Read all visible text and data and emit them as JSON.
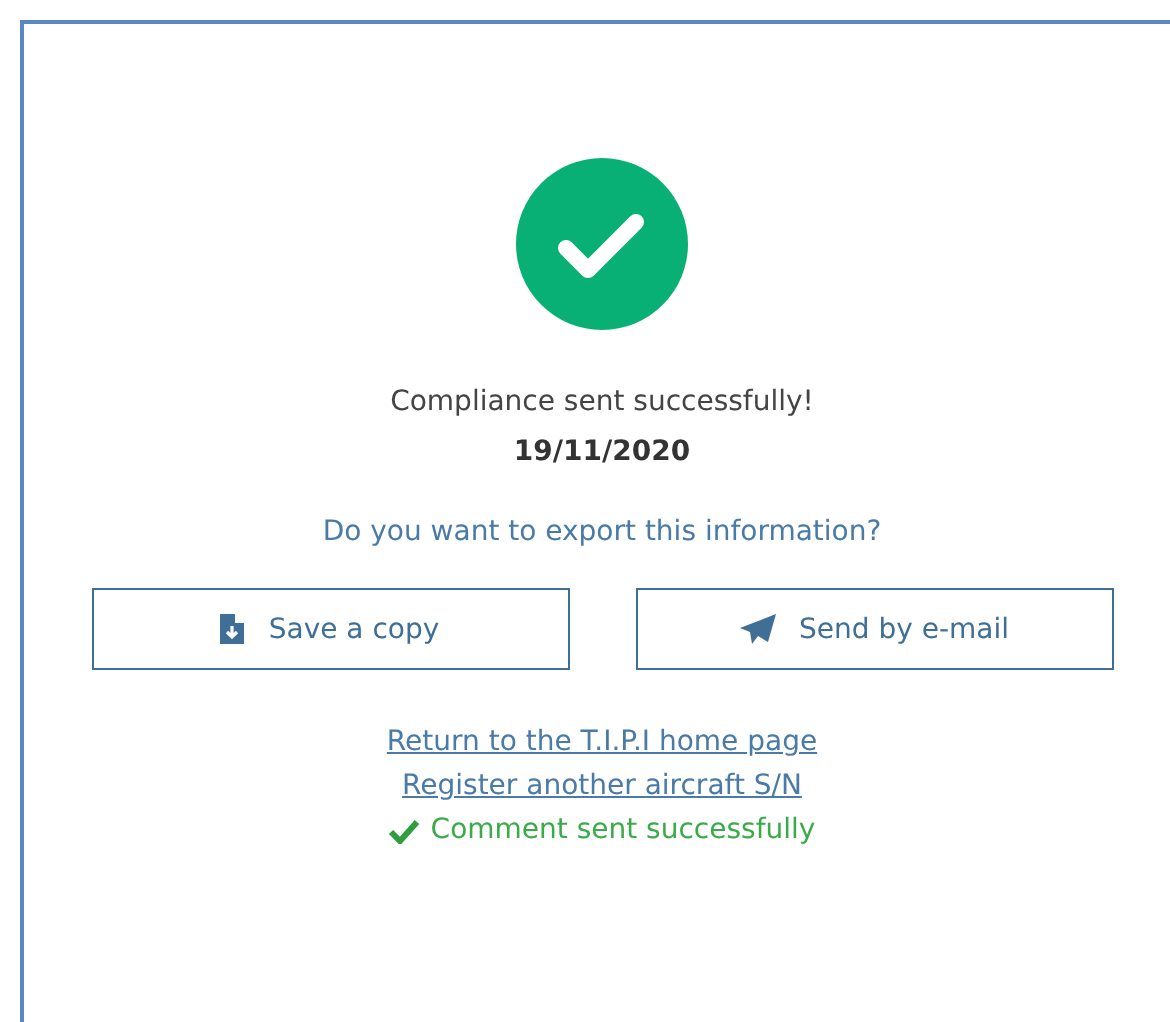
{
  "message": "Compliance sent successfully!",
  "date": "19/11/2020",
  "question": "Do you want to export this information?",
  "buttons": [
    {
      "kind": "save",
      "label": "Save a copy"
    },
    {
      "kind": "email",
      "label": "Send by e-mail"
    }
  ],
  "links": [
    "Return to the T.I.P.I home page",
    "Register another aircraft S/N"
  ],
  "comment_status": "Comment sent successfully"
}
